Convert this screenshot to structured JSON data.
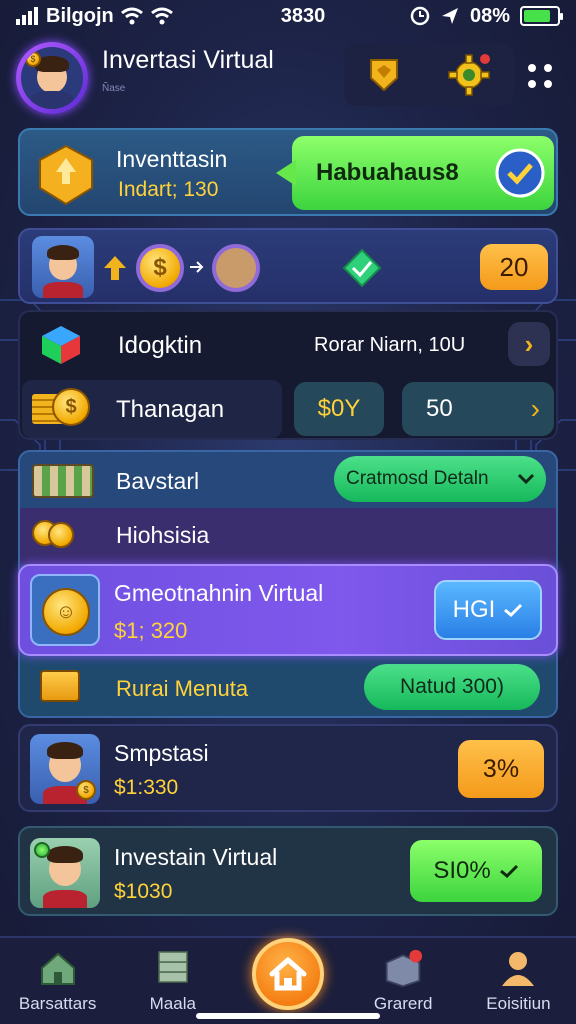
{
  "status": {
    "carrier": "Bilgojn",
    "time": "3830",
    "battery_text": "08%",
    "battery_level": 0.8
  },
  "header": {
    "title": "Invertasi Virtual",
    "subtitle": "Ñase"
  },
  "card1": {
    "title": "Inventtasin",
    "value": "Indart; 130",
    "button_label": "Habuahaus8"
  },
  "card2": {
    "badge_value": "20"
  },
  "row3": {
    "label": "Idogktin",
    "value": "Rorar Niarn, 10U"
  },
  "row4": {
    "label": "Thanagan",
    "chip1": "$0Y",
    "chip2": "50"
  },
  "row5": {
    "label": "Bavstarl",
    "dropdown": "Cratmosd Detaln"
  },
  "row6": {
    "label": "Hiohsisia"
  },
  "highlight": {
    "title": "Gmeotnahnin Virtual",
    "value": "$1; 320",
    "button_label": "HGI"
  },
  "row7": {
    "label": "Rurai Menuta",
    "button_label": "Natud 300)"
  },
  "card8": {
    "title": "Smpstasi",
    "value": "$1:330",
    "button_label": "3%"
  },
  "card9": {
    "title": "Investain Virtual",
    "value": "$1030",
    "button_label": "SI0%"
  },
  "nav": {
    "item1": "Barsattars",
    "item2": "Maala",
    "item3": "Grarerd",
    "item4": "Eoisitiun"
  },
  "icons": [
    "signal-icon",
    "wifi-icon",
    "alarm-icon",
    "location-icon",
    "battery-icon",
    "rank-badge-icon",
    "gear-icon",
    "menu-dots-icon",
    "shield-icon",
    "coin-icon",
    "check-circle-icon",
    "cube-icon",
    "chevron-right-icon",
    "money-stack-icon",
    "chevron-down-icon",
    "home-icon",
    "safe-icon",
    "user-icon"
  ],
  "colors": {
    "accent_orange": "#f49a1a",
    "accent_green": "#3cd43e",
    "accent_purple": "#7a4fe8",
    "accent_blue": "#2a7fe6",
    "background": "#1d2347"
  }
}
